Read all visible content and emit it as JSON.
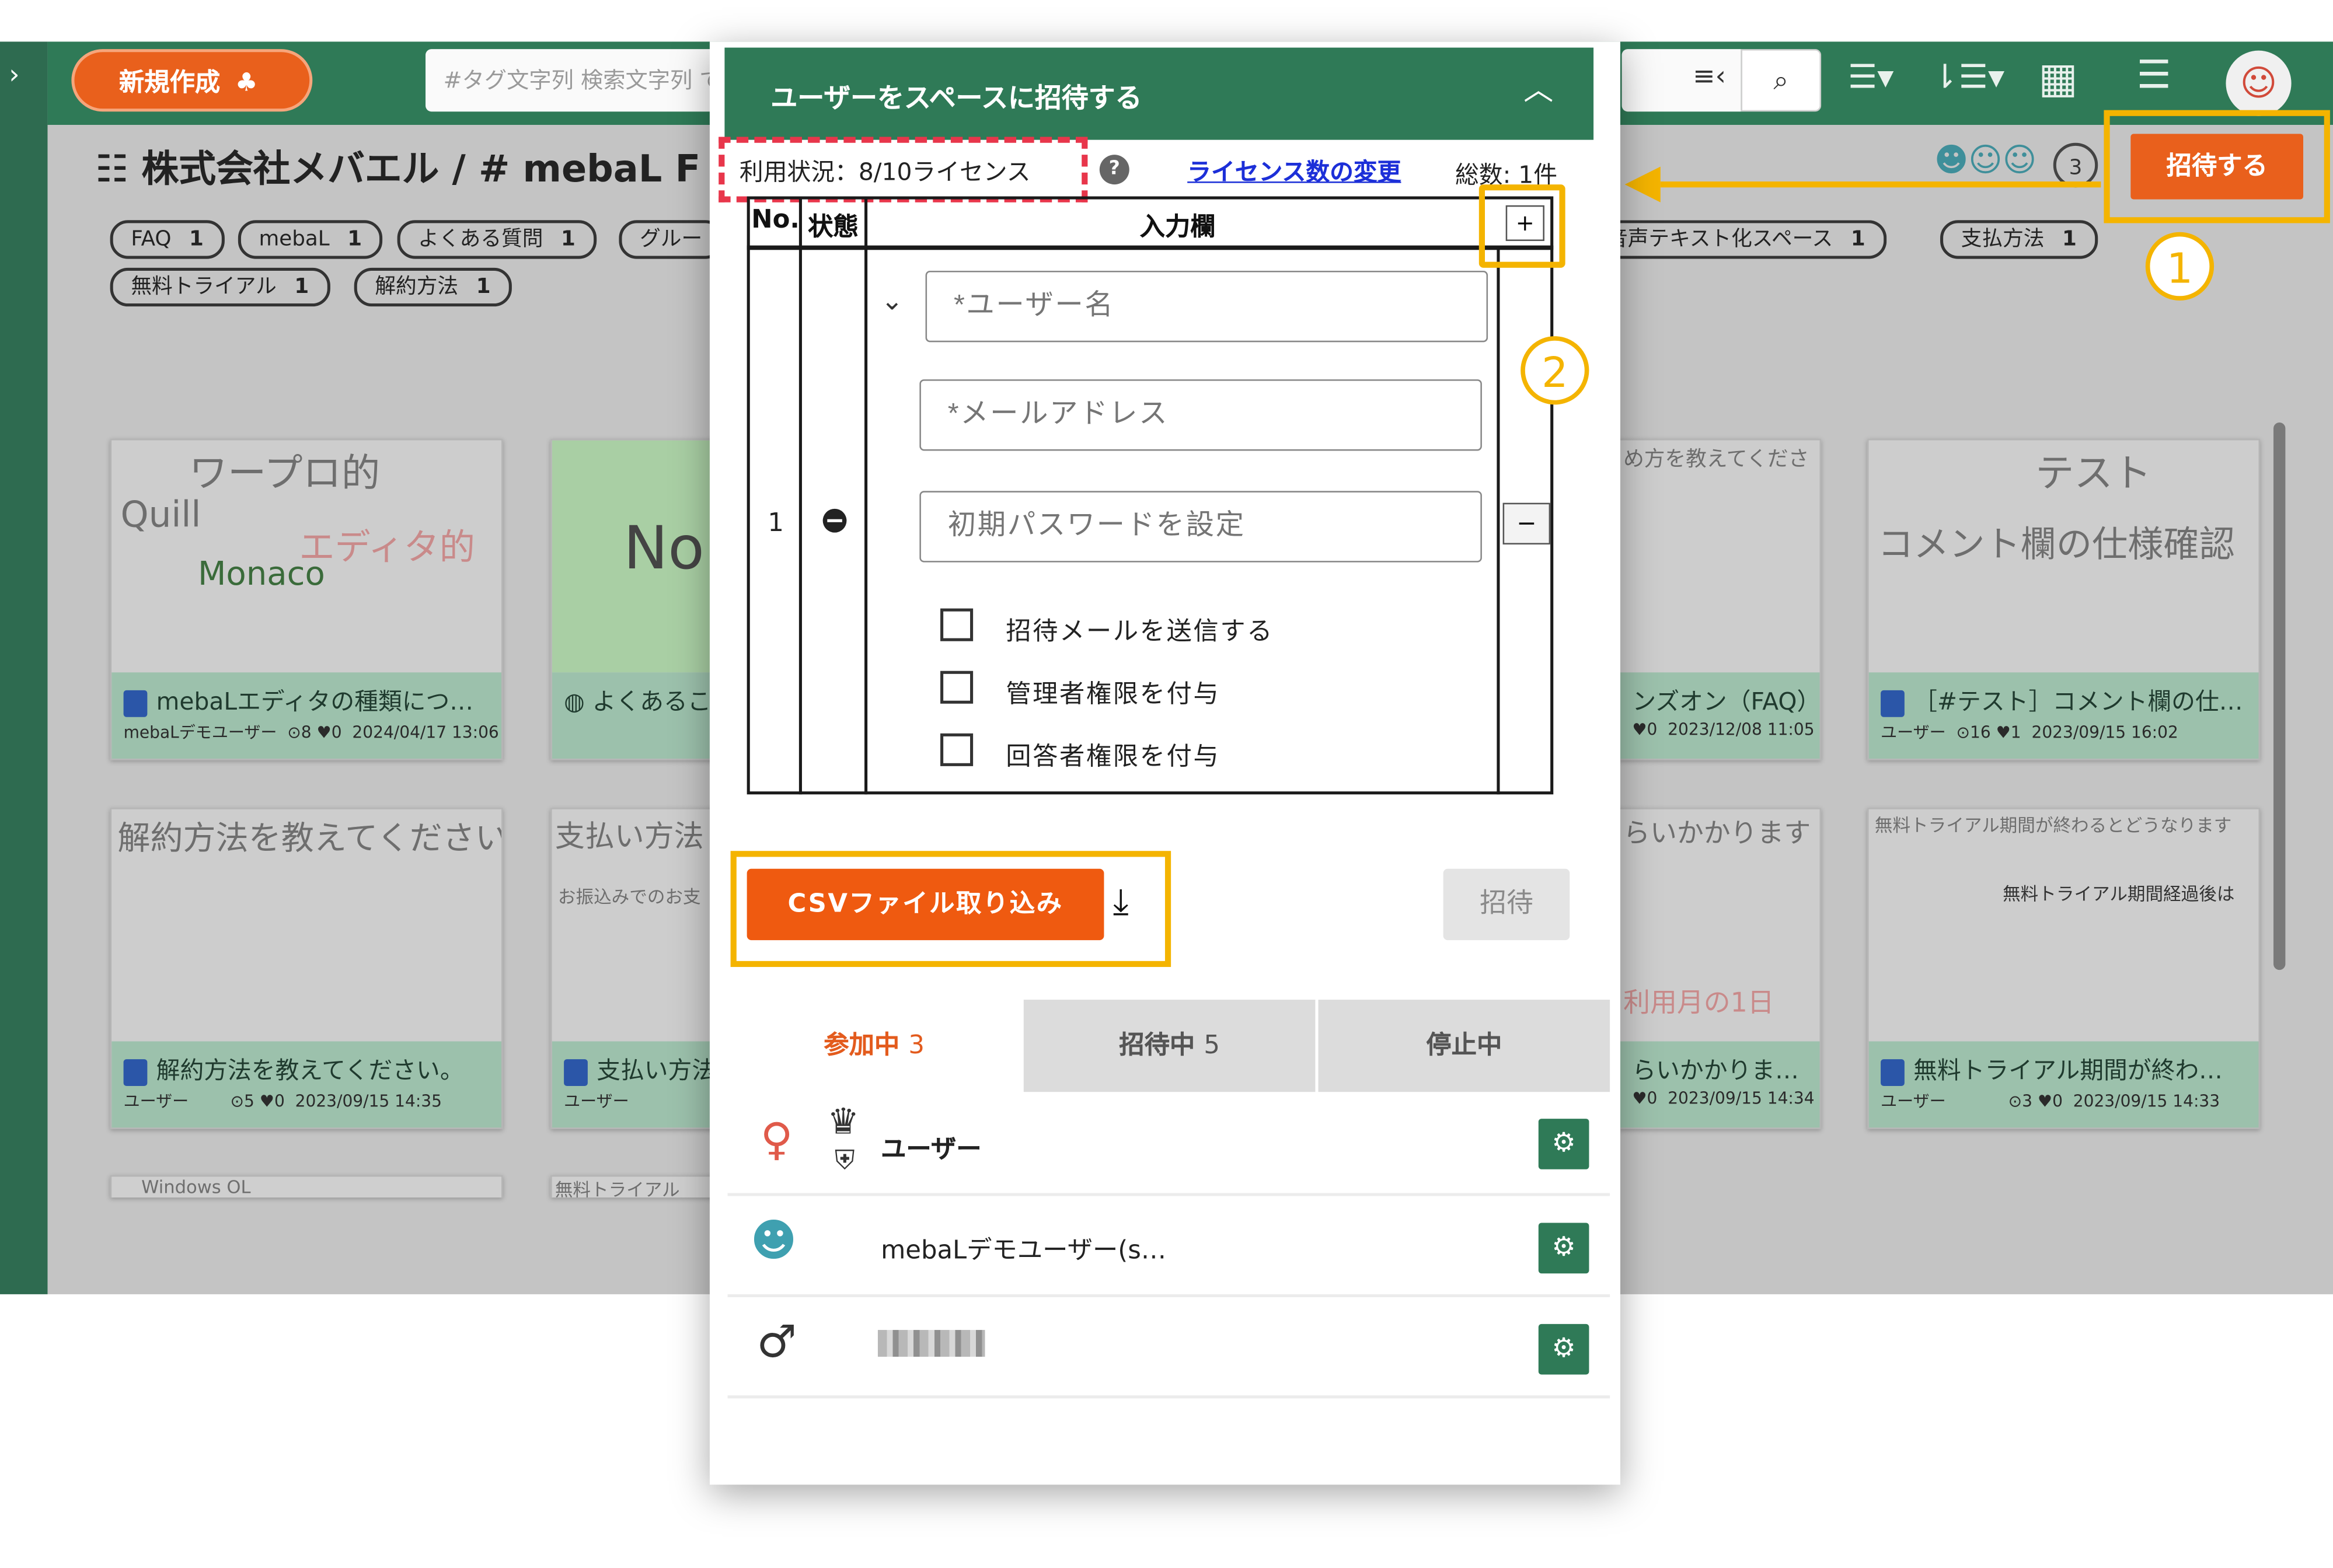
{
  "app": {
    "new_button": "新規作成",
    "new_icon": "sprout-icon",
    "search_placeholder": "#タグ文字列 検索文字列 で",
    "breadcrumb": "株式会社メバエル / # mebaL F",
    "invite_button": "招待する",
    "member_count": "3",
    "tags": [
      {
        "label": "FAQ",
        "count": "1"
      },
      {
        "label": "mebaL",
        "count": "1"
      },
      {
        "label": "よくある質問",
        "count": "1"
      },
      {
        "label": "グルー",
        "count": ""
      },
      {
        "label": "音声テキスト化スペース",
        "count": "1"
      },
      {
        "label": "支払方法",
        "count": "1"
      },
      {
        "label": "無料トライアル",
        "count": "1"
      },
      {
        "label": "解約方法",
        "count": "1"
      }
    ],
    "cards": [
      {
        "title": "mebaLエディタの種類につ…",
        "user": "mebaLデモユーザー",
        "views": "8",
        "likes": "0",
        "date": "2024/04/17 13:06",
        "thumb_big": "ワープロ的",
        "thumb_sub": "Quill",
        "thumb_sub2": "Monaco",
        "thumb_mid": "エディタ的"
      },
      {
        "title": "よくあるこ",
        "user": "",
        "views": "",
        "likes": "",
        "date": "",
        "thumb_big": "No"
      },
      {
        "title": "ンズオン（FAQ）",
        "user": "",
        "views": "",
        "likes": "0",
        "date": "2023/12/08 11:05",
        "thumb_big": "め方を教えてくださ"
      },
      {
        "title": "［#テスト］コメント欄の仕…",
        "user": "ユーザー",
        "views": "16",
        "likes": "1",
        "date": "2023/09/15 16:02",
        "thumb_big": "テスト",
        "thumb_sub": "コメント欄の仕様確認"
      },
      {
        "title": "解約方法を教えてください。",
        "user": "ユーザー",
        "views": "5",
        "likes": "0",
        "date": "2023/09/15 14:35",
        "thumb_big": "解約方法を教えてください"
      },
      {
        "title": "支払い方法",
        "user": "ユーザー",
        "views": "",
        "likes": "",
        "date": "",
        "thumb_big": "支払い方法",
        "thumb_sub": "お振込みでのお支"
      },
      {
        "title": "らいかかりま…",
        "user": "",
        "views": "",
        "likes": "0",
        "date": "2023/09/15 14:34",
        "thumb_big": "らいかかります",
        "thumb_sub": "利用月の1日"
      },
      {
        "title": "無料トライアル期間が終わ…",
        "user": "ユーザー",
        "views": "3",
        "likes": "0",
        "date": "2023/09/15 14:33",
        "thumb_big": "無料トライアル期間が終わるとどうなります",
        "thumb_sub": "無料トライアル期間経過後は"
      }
    ],
    "bottom_peek": [
      "Windows OL",
      "無料トライアル"
    ]
  },
  "modal": {
    "title": "ユーザーをスペースに招待する",
    "usage": "利用状況：8/10ライセンス",
    "license_link": "ライセンス数の変更",
    "total": "総数: 1件",
    "columns": {
      "no": "No.",
      "status": "状態",
      "input": "入力欄"
    },
    "row_number": "1",
    "fields": {
      "username": "*ユーザー名",
      "email": "*メールアドレス",
      "password": "初期パスワードを設定"
    },
    "checkboxes": [
      {
        "label": "招待メールを送信する",
        "checked": false
      },
      {
        "label": "管理者権限を付与",
        "checked": false
      },
      {
        "label": "回答者権限を付与",
        "checked": false
      }
    ],
    "csv_button": "CSVファイル取り込み",
    "invite_submit": "招待",
    "tabs": [
      {
        "label": "参加中",
        "count": "3",
        "active": true
      },
      {
        "label": "招待中",
        "count": "5",
        "active": false
      },
      {
        "label": "停止中",
        "count": "",
        "active": false
      }
    ],
    "members": [
      {
        "name": "ユーザー",
        "avatar": "female-user-avatar",
        "admin": true
      },
      {
        "name": "mebaLデモユーザー(s…",
        "avatar": "bird-mascot-avatar",
        "admin": false
      },
      {
        "name": "",
        "avatar": "male-user-avatar",
        "admin": false
      }
    ]
  },
  "annotations": {
    "step1": "1",
    "step2": "2"
  },
  "colors": {
    "brand_green": "#2f7a57",
    "accent_orange": "#e9601c",
    "highlight": "#f4b400",
    "usage_box": "#e8364b",
    "link": "#1c2fd8"
  }
}
